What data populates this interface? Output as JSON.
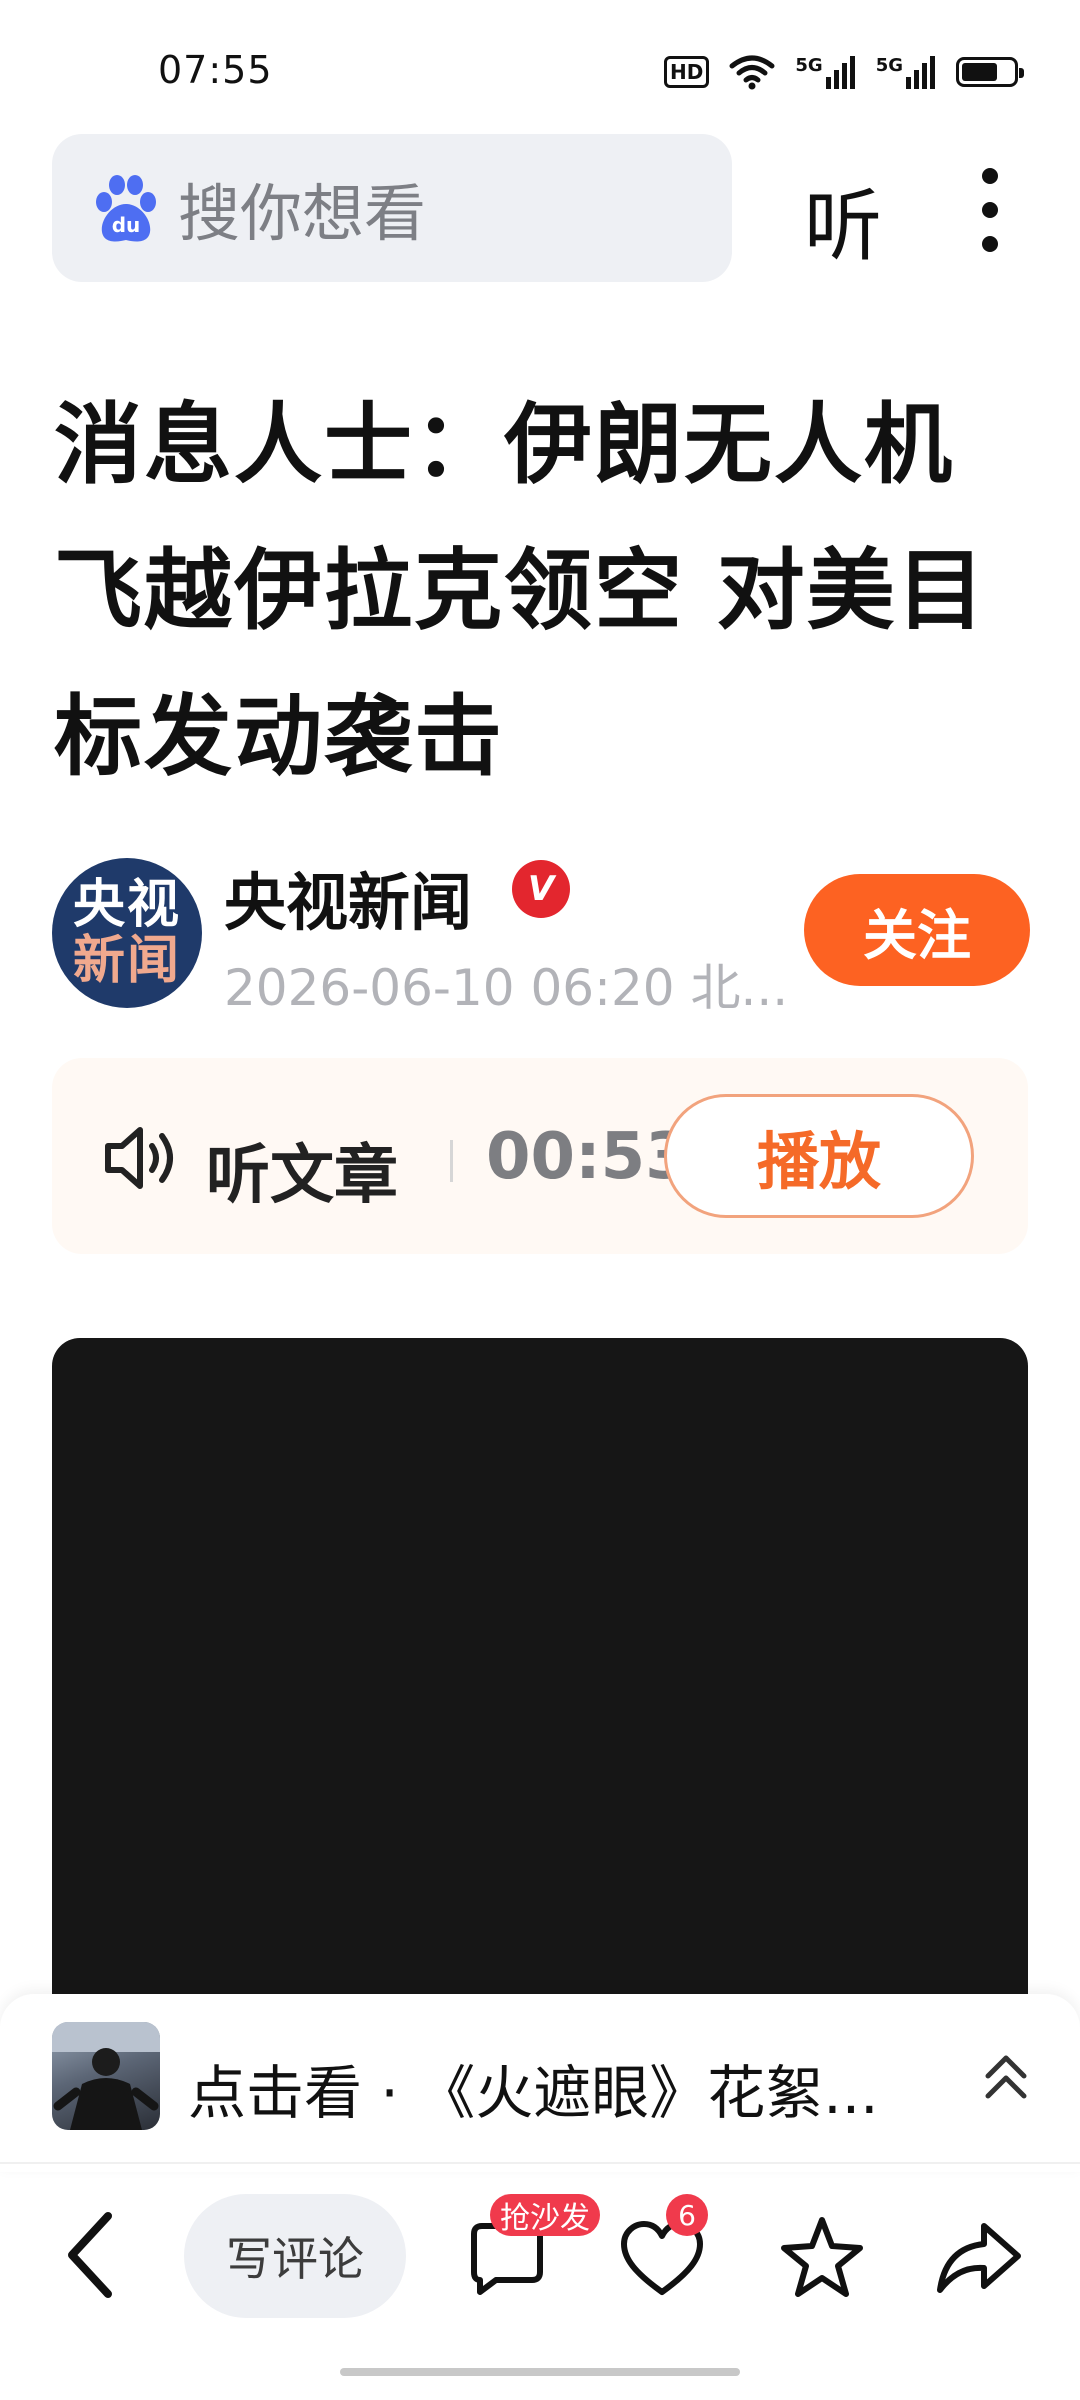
{
  "status_bar": {
    "time": "07:55",
    "hd_label": "HD",
    "net1": "5G",
    "net2": "5G",
    "battery_level": 0.7,
    "icons": [
      "hd-icon",
      "wifi-icon",
      "signal-5g-icon",
      "signal-5g-icon",
      "battery-icon"
    ]
  },
  "header": {
    "search_placeholder": "搜你想看",
    "logo_text": "du",
    "listen_label": "听",
    "icons": [
      "baidu-paw-logo",
      "more-icon"
    ]
  },
  "article": {
    "title": "消息人士：伊朗无人机飞越伊拉克领空 对美目标发动袭击",
    "author": {
      "avatar_line1": "央视",
      "avatar_line2": "新闻",
      "name": "央视新闻",
      "verified_mark": "V",
      "meta": "2026-06-10 06:20  北...",
      "follow_label": "关注"
    },
    "listen": {
      "label": "听文章",
      "duration": "00:53",
      "play_label": "播放"
    }
  },
  "promo": {
    "text": "点击看 · 《火遮眼》花絮..."
  },
  "bottom_bar": {
    "comment_placeholder": "写评论",
    "sofa_badge": "抢沙发",
    "like_count": "6",
    "icons": [
      "back-arrow-icon",
      "comment-icon",
      "heart-icon",
      "star-icon",
      "share-icon"
    ]
  },
  "colors": {
    "accent_orange": "#fd6222",
    "badge_red": "#f03a4c",
    "verified_red": "#e3262e",
    "search_bg": "#eef0f4",
    "baidu_blue": "#4e6ef2"
  }
}
